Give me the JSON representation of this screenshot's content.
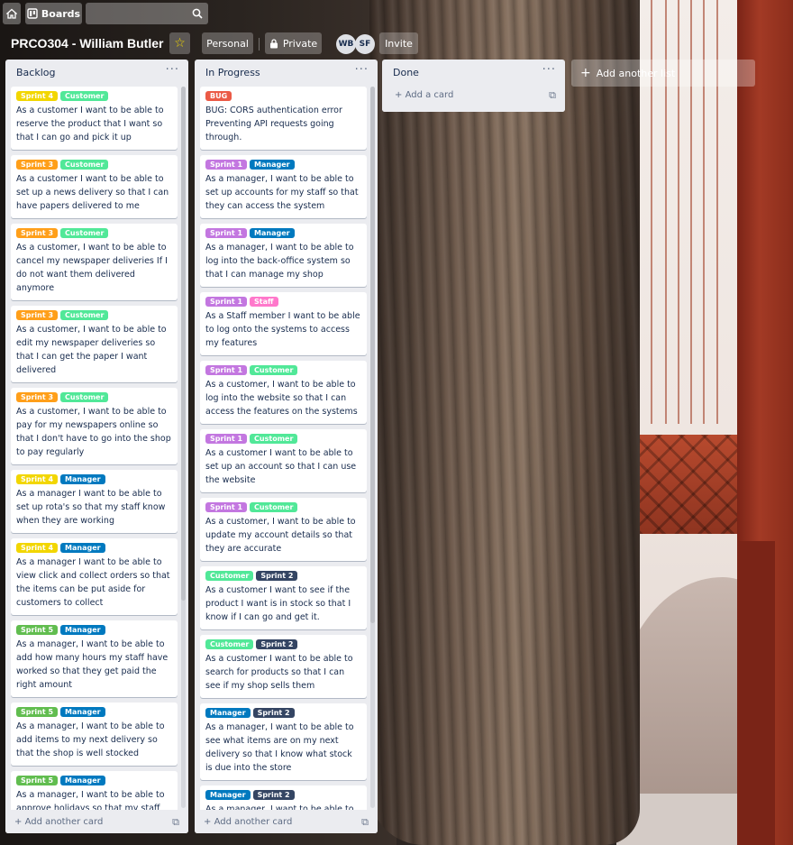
{
  "colors": {
    "orange": "#ff9f1a",
    "yellow": "#f2d600",
    "green": "#61bd4f",
    "sky": "#51e898",
    "blue": "#0079bf",
    "purple": "#c377e0",
    "pink": "#ff78cb",
    "red": "#eb5a46",
    "navy": "#344563"
  },
  "nav": {
    "home_icon": "home-icon",
    "boards_label": "Boards",
    "search_icon": "search-icon"
  },
  "board": {
    "title": "PRCO304 - William Butler",
    "personal_label": "Personal",
    "private_label": "Private",
    "members": [
      "WB",
      "SF"
    ],
    "invite_label": "Invite"
  },
  "lists": [
    {
      "title": "Backlog",
      "add_card": "Add another card",
      "cards": [
        {
          "labels": [
            {
              "text": "Sprint 4",
              "color": "yellow"
            },
            {
              "text": "Customer",
              "color": "sky"
            }
          ],
          "text": "As a customer I want to be able to reserve the product that I want so that I can go and pick it up"
        },
        {
          "labels": [
            {
              "text": "Sprint 3",
              "color": "orange"
            },
            {
              "text": "Customer",
              "color": "sky"
            }
          ],
          "text": "As a customer I want to be able to set up a news delivery so that I can have papers delivered to me"
        },
        {
          "labels": [
            {
              "text": "Sprint 3",
              "color": "orange"
            },
            {
              "text": "Customer",
              "color": "sky"
            }
          ],
          "text": "As a customer, I want to be able to cancel my newspaper deliveries If I do not want them delivered anymore"
        },
        {
          "labels": [
            {
              "text": "Sprint 3",
              "color": "orange"
            },
            {
              "text": "Customer",
              "color": "sky"
            }
          ],
          "text": "As a customer, I want to be able to edit my newspaper deliveries so that I can get the paper I want delivered"
        },
        {
          "labels": [
            {
              "text": "Sprint 3",
              "color": "orange"
            },
            {
              "text": "Customer",
              "color": "sky"
            }
          ],
          "text": "As a customer, I want to be able to pay for my newspapers online so that I don't have to go into the shop to pay regularly"
        },
        {
          "labels": [
            {
              "text": "Sprint 4",
              "color": "yellow"
            },
            {
              "text": "Manager",
              "color": "blue"
            }
          ],
          "text": "As a manager I want to be able to set up rota's so that my staff know when they are working"
        },
        {
          "labels": [
            {
              "text": "Sprint 4",
              "color": "yellow"
            },
            {
              "text": "Manager",
              "color": "blue"
            }
          ],
          "text": "As a manager I want to be able to view click and collect orders so that the items can be put aside for customers to collect"
        },
        {
          "labels": [
            {
              "text": "Sprint 5",
              "color": "green"
            },
            {
              "text": "Manager",
              "color": "blue"
            }
          ],
          "text": "As a manager, I want to be able to add how many hours my staff have worked so that they get paid the right amount"
        },
        {
          "labels": [
            {
              "text": "Sprint 5",
              "color": "green"
            },
            {
              "text": "Manager",
              "color": "blue"
            }
          ],
          "text": "As a manager, I want to be able to add items to my next delivery so that the shop is well stocked"
        },
        {
          "labels": [
            {
              "text": "Sprint 5",
              "color": "green"
            },
            {
              "text": "Manager",
              "color": "blue"
            }
          ],
          "text": "As a manager, I want to be able to approve holidays so that my staff can have time off when they have requested"
        }
      ]
    },
    {
      "title": "In Progress",
      "add_card": "Add another card",
      "cards": [
        {
          "labels": [
            {
              "text": "BUG",
              "color": "red"
            }
          ],
          "text": "BUG: CORS authentication error Preventing API requests going through."
        },
        {
          "labels": [
            {
              "text": "Sprint 1",
              "color": "purple"
            },
            {
              "text": "Manager",
              "color": "blue"
            }
          ],
          "text": "As a manager, I want to be able to set up accounts for my staff so that they can access the system"
        },
        {
          "labels": [
            {
              "text": "Sprint 1",
              "color": "purple"
            },
            {
              "text": "Manager",
              "color": "blue"
            }
          ],
          "text": "As a manager, I want to be able to log into the back-office system so that I can manage my shop"
        },
        {
          "labels": [
            {
              "text": "Sprint 1",
              "color": "purple"
            },
            {
              "text": "Staff",
              "color": "pink"
            }
          ],
          "text": "As a Staff member I want to be able to log onto the systems to access my features"
        },
        {
          "labels": [
            {
              "text": "Sprint 1",
              "color": "purple"
            },
            {
              "text": "Customer",
              "color": "sky"
            }
          ],
          "text": "As a customer, I want to be able to log into the website so that I can access the features on the systems"
        },
        {
          "labels": [
            {
              "text": "Sprint 1",
              "color": "purple"
            },
            {
              "text": "Customer",
              "color": "sky"
            }
          ],
          "text": "As a customer I want to be able to set up an account so that I can use the website"
        },
        {
          "labels": [
            {
              "text": "Sprint 1",
              "color": "purple"
            },
            {
              "text": "Customer",
              "color": "sky"
            }
          ],
          "text": "As a customer, I want to be able to update my account details so that they are accurate"
        },
        {
          "labels": [
            {
              "text": "Customer",
              "color": "sky"
            },
            {
              "text": "Sprint 2",
              "color": "navy"
            }
          ],
          "text": "As a customer I want to see if the product I want is in stock so that I know if I can go and get it."
        },
        {
          "labels": [
            {
              "text": "Customer",
              "color": "sky"
            },
            {
              "text": "Sprint 2",
              "color": "navy"
            }
          ],
          "text": "As a customer I want to be able to search for products so that I can see if my shop sells them"
        },
        {
          "labels": [
            {
              "text": "Manager",
              "color": "blue"
            },
            {
              "text": "Sprint 2",
              "color": "navy"
            }
          ],
          "text": "As a manager, I want to be able to see what items are on my next delivery so that I know what stock is due into the store"
        },
        {
          "labels": [
            {
              "text": "Manager",
              "color": "blue"
            },
            {
              "text": "Sprint 2",
              "color": "navy"
            }
          ],
          "text": "As a manager, I want to be able to"
        }
      ]
    },
    {
      "title": "Done",
      "add_card": "Add a card",
      "cards": []
    }
  ],
  "add_list_label": "Add another list"
}
